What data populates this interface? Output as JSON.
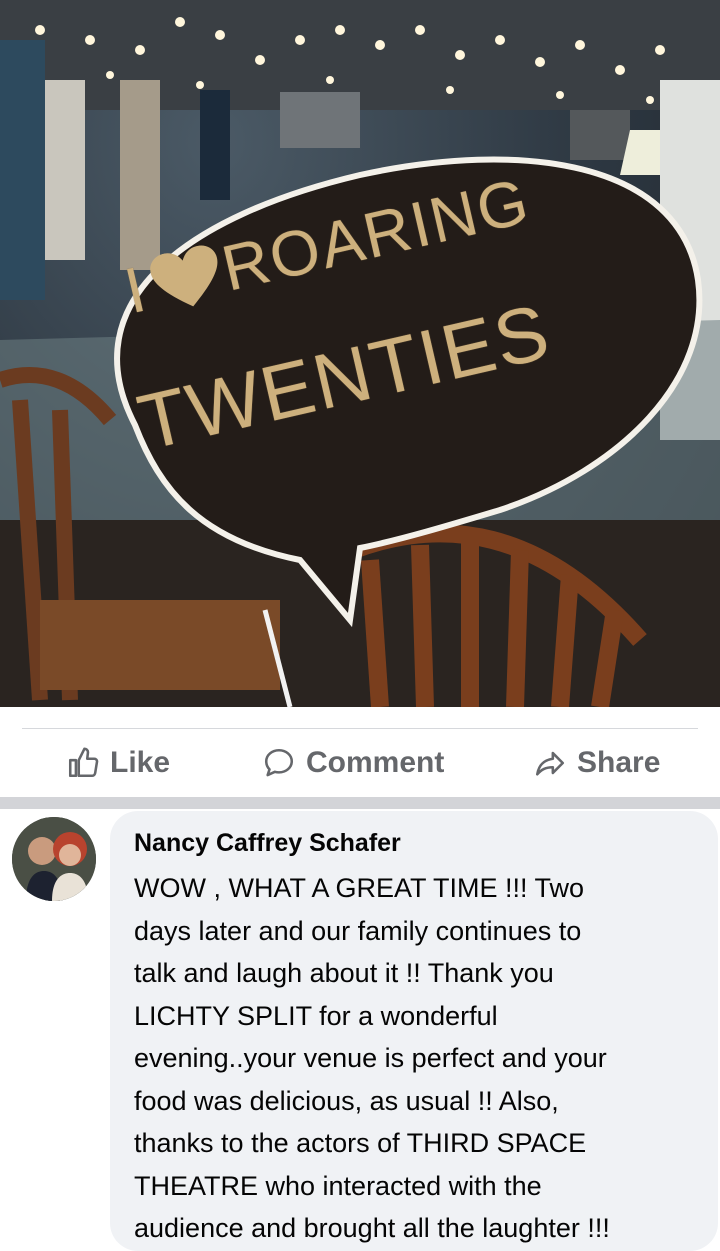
{
  "photo": {
    "sign_line_1_prefix": "I",
    "sign_line_1_suffix": "ROARING",
    "sign_line_2": "TWENTIES",
    "heart_icon": "heart-icon",
    "sign_color": "#cdb07d"
  },
  "actions": {
    "like_label": "Like",
    "comment_label": "Comment",
    "share_label": "Share"
  },
  "comment": {
    "author": "Nancy Caffrey Schafer",
    "text": "WOW , WHAT A GREAT TIME !!!  Two\ndays later and our family continues to\ntalk and laugh about it !!  Thank you\nLICHTY SPLIT for a wonderful\nevening..your venue is perfect and your\nfood was delicious, as usual !!  Also,\nthanks to the actors of THIRD SPACE\nTHEATRE who interacted with the\naudience and brought all the laughter !!!"
  }
}
